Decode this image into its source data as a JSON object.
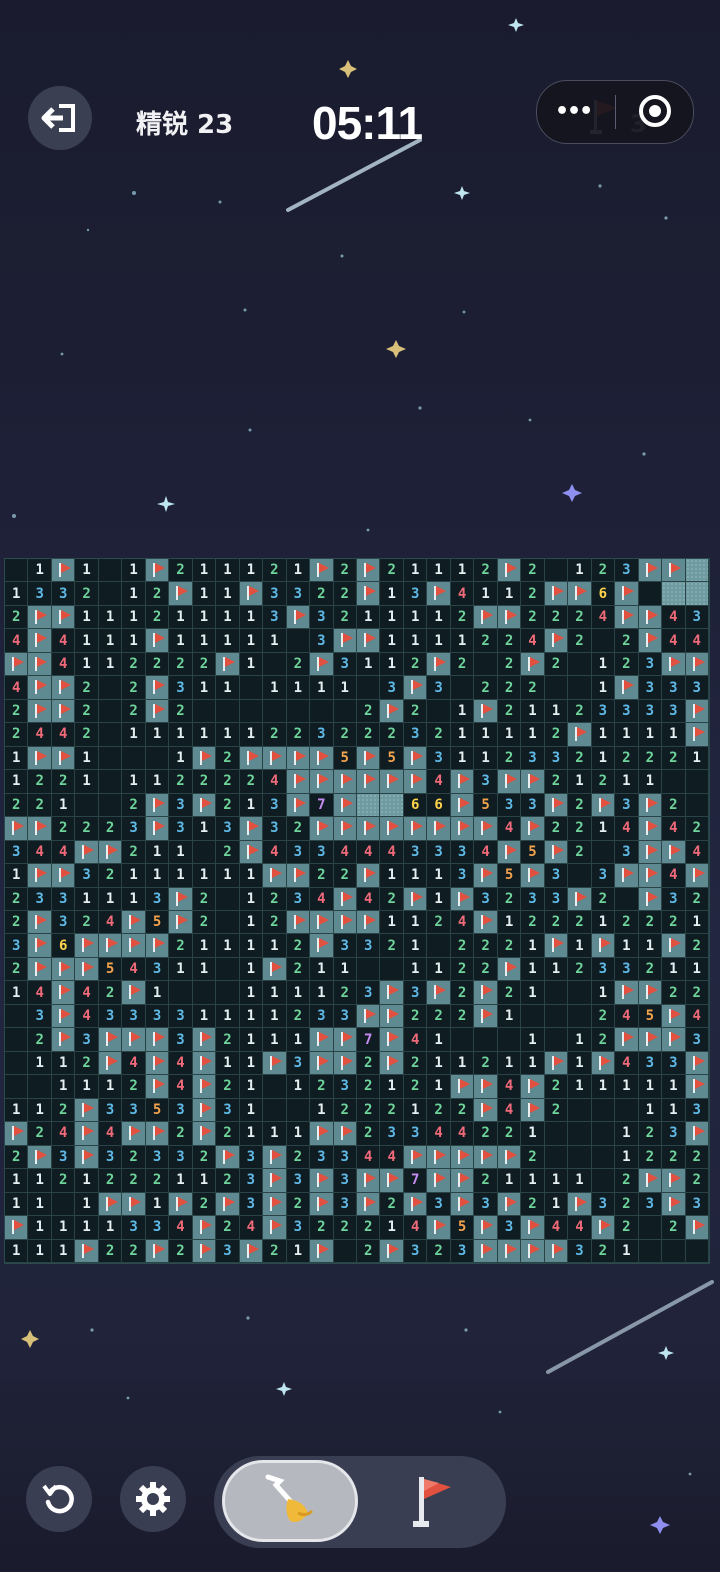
{
  "header": {
    "level_label": "精锐 23",
    "timer": "05:11",
    "capsule_menu_icon": "more-dots-icon",
    "capsule_target_icon": "target-icon",
    "flags_remaining": "3"
  },
  "board": {
    "cols": 30,
    "rows": 30,
    "legend": "F=flag, H=hidden, _=empty, digits=count",
    "grid": [
      "_1F1_1F211121F2F21112F2_123FFHHHH",
      "1332_12F11F3322F13F4112FF6F_HHH",
      "2FF111211113F3211112FF2224FF43",
      "4F4111F11111_3FF1111224F2_2F44",
      "FF4112222F1_2F3112F2_2F2_123FF",
      "4FF2_2F311_1111_3F3_222__1F333",
      "2FF2_2F2_______2F2_1F21123333F",
      "2442_1111112232223211112F1111F",
      "1FF1___1F2FFFF5F5F3112332122211",
      "1221_1122224FFFFFF4F3FF21211__",
      "221__2F3F213F7FHH66F533F2F3F2_",
      "FF2223F313F32FFFFFFFF4F2214F421",
      "344FF211_2F4334443334F5F2_3FF4F",
      "1FF32111111FF22F1113F5F3_3FF4F",
      "2331113F2_1234F42F1F3233F2_F321",
      "2F324F5F2_12FFFF1124F1222122211",
      "3F6FFFF211112F3321_2221F1F11F2",
      "2FFF54311_1F211__1122F1123321113F",
      "14F42F1___111123F3F2F21__1FF2224F",
      "_3F433331111233FF222F1___245F4F4F",
      "_2F3FFF3F2111FF7F41___1_12FFF33F2",
      "_112F4F4F11F3FF2F211211F1F433F232",
      "__1112F4F21_1232121FF4F211111F3F3F",
      "112F3353F31__1222122F4F2___113F42",
      "F24F4FF2F2111FF23344221___123F",
      "2F3F32332F3F23344FFFFF2___12222F2",
      "11212221123F3F3FF7FF21111_2FF211",
      "11_1FF1F2F3F2F3F2F3F3F21F323F3F111",
      "F1111334F24F322214F5F3F44F2_2F1____1F",
      "111F22F2F3F21F_2F323FFFF321___11"
    ]
  },
  "controls": {
    "restart_icon": "restart-icon",
    "settings_icon": "gear-icon",
    "dig_icon": "shovel-icon",
    "flag_icon": "flag-icon"
  },
  "colors": {
    "n1": "#e6f0f2",
    "n2": "#6fd49b",
    "n3": "#5fb9e6",
    "n4": "#f06a7a",
    "n5": "#f3a24d",
    "n6": "#ffd34a",
    "n7": "#c48cf0",
    "flag": "#e2503f"
  }
}
